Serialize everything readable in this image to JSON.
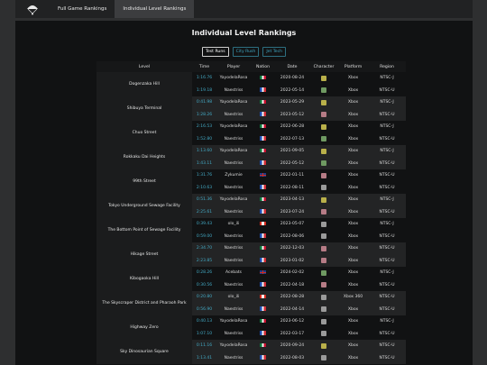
{
  "nav": {
    "logo_icon": "parachute-icon",
    "tabs": [
      {
        "label": "Full Game Rankings",
        "active": false
      },
      {
        "label": "Individual Level Rankings",
        "active": true
      }
    ]
  },
  "page_title": "Individual Level Rankings",
  "filters": [
    {
      "label": "Test Runs",
      "active": true
    },
    {
      "label": "City Rush",
      "active": false
    },
    {
      "label": "Jet Tech",
      "active": false
    }
  ],
  "table": {
    "headers": [
      "Level",
      "Time",
      "Player",
      "Nation",
      "Date",
      "Character",
      "Platform",
      "Region"
    ],
    "groups": [
      {
        "level": "Dogenzaka Hill",
        "runs": [
          {
            "time": "1:16.76",
            "player": "YayodelaRosa",
            "nation": "mx",
            "date": "2020-08-24",
            "character": "yellow",
            "platform": "Xbox",
            "region": "NTSC-J"
          },
          {
            "time": "1:19.18",
            "player": "Naestriss",
            "nation": "fr",
            "date": "2022-05-14",
            "character": "green",
            "platform": "Xbox",
            "region": "NTSC-U"
          }
        ]
      },
      {
        "level": "Shibuya Terminal",
        "runs": [
          {
            "time": "0:41.98",
            "player": "YayodelaRosa",
            "nation": "mx",
            "date": "2023-05-29",
            "character": "yellow",
            "platform": "Xbox",
            "region": "NTSC-J"
          },
          {
            "time": "1:28.26",
            "player": "Naestriss",
            "nation": "fr",
            "date": "2023-05-12",
            "character": "pink",
            "platform": "Xbox",
            "region": "NTSC-U"
          }
        ]
      },
      {
        "level": "Chuo Street",
        "runs": [
          {
            "time": "2:16.53",
            "player": "YayodelaRosa",
            "nation": "mx",
            "date": "2022-06-28",
            "character": "yellow",
            "platform": "Xbox",
            "region": "NTSC-J"
          },
          {
            "time": "1:52.80",
            "player": "Naestriss",
            "nation": "fr",
            "date": "2022-07-13",
            "character": "green",
            "platform": "Xbox",
            "region": "NTSC-U"
          }
        ]
      },
      {
        "level": "Rokkaku Dai Heights",
        "runs": [
          {
            "time": "1:13.60",
            "player": "YayodelaRosa",
            "nation": "mx",
            "date": "2021-09-05",
            "character": "yellow",
            "platform": "Xbox",
            "region": "NTSC-J"
          },
          {
            "time": "1:43.11",
            "player": "Naestriss",
            "nation": "fr",
            "date": "2022-05-12",
            "character": "green",
            "platform": "Xbox",
            "region": "NTSC-U"
          }
        ]
      },
      {
        "level": "99th Street",
        "runs": [
          {
            "time": "1:31.76",
            "player": "Zykumie",
            "nation": "uk",
            "date": "2022-01-11",
            "character": "pink",
            "platform": "Xbox",
            "region": "NTSC-U"
          },
          {
            "time": "2:10.63",
            "player": "Naestriss",
            "nation": "fr",
            "date": "2022-08-11",
            "character": "gray",
            "platform": "Xbox",
            "region": "NTSC-U"
          }
        ]
      },
      {
        "level": "Tokyo Underground Sewage Facility",
        "runs": [
          {
            "time": "0:51.36",
            "player": "YayodelaRosa",
            "nation": "mx",
            "date": "2023-04-13",
            "character": "yellow",
            "platform": "Xbox",
            "region": "NTSC-J"
          },
          {
            "time": "2:25.61",
            "player": "Naestriss",
            "nation": "fr",
            "date": "2023-07-24",
            "character": "pink",
            "platform": "Xbox",
            "region": "NTSC-U"
          }
        ]
      },
      {
        "level": "The Bottom Point of Sewage Facility",
        "runs": [
          {
            "time": "0:39.43",
            "player": "olo_ili",
            "nation": "ca",
            "date": "2023-05-07",
            "character": "gray",
            "platform": "Xbox",
            "region": "NTSC-J"
          },
          {
            "time": "0:59.00",
            "player": "Naestriss",
            "nation": "fr",
            "date": "2022-08-06",
            "character": "gray",
            "platform": "Xbox",
            "region": "NTSC-U"
          }
        ]
      },
      {
        "level": "Hikage Street",
        "runs": [
          {
            "time": "2:34.70",
            "player": "Naestriss",
            "nation": "mx",
            "date": "2022-12-03",
            "character": "pink",
            "platform": "Xbox",
            "region": "NTSC-U"
          },
          {
            "time": "2:23.85",
            "player": "Naestriss",
            "nation": "fr",
            "date": "2023-01-02",
            "character": "pink",
            "platform": "Xbox",
            "region": "NTSC-U"
          }
        ]
      },
      {
        "level": "Kibogaoka Hill",
        "runs": [
          {
            "time": "0:28.26",
            "player": "Acebats",
            "nation": "uk",
            "date": "2024-02-02",
            "character": "green",
            "platform": "Xbox",
            "region": "NTSC-J"
          },
          {
            "time": "0:30.56",
            "player": "Naestriss",
            "nation": "fr",
            "date": "2022-04-18",
            "character": "pink",
            "platform": "Xbox",
            "region": "NTSC-U"
          }
        ]
      },
      {
        "level": "The Skyscraper District and Pharaoh Park",
        "runs": [
          {
            "time": "0:20.80",
            "player": "olo_ili",
            "nation": "ca",
            "date": "2022-08-28",
            "character": "gray",
            "platform": "Xbox 360",
            "region": "NTSC-U"
          },
          {
            "time": "0:56.90",
            "player": "Naestriss",
            "nation": "fr",
            "date": "2022-04-14",
            "character": "gray",
            "platform": "Xbox",
            "region": "NTSC-U"
          }
        ]
      },
      {
        "level": "Highway Zero",
        "runs": [
          {
            "time": "0:40.13",
            "player": "YayodelaRosa",
            "nation": "mx",
            "date": "2023-06-12",
            "character": "gray",
            "platform": "Xbox",
            "region": "NTSC-J"
          },
          {
            "time": "1:07.10",
            "player": "Naestriss",
            "nation": "fr",
            "date": "2022-03-17",
            "character": "gray",
            "platform": "Xbox",
            "region": "NTSC-U"
          }
        ]
      },
      {
        "level": "Sky Dinosaurian Square",
        "runs": [
          {
            "time": "0:11.16",
            "player": "YayodelaRosa",
            "nation": "mx",
            "date": "2020-09-24",
            "character": "yellow",
            "platform": "Xbox",
            "region": "NTSC-U"
          },
          {
            "time": "1:13.41",
            "player": "Naestriss",
            "nation": "fr",
            "date": "2022-08-03",
            "character": "gray",
            "platform": "Xbox",
            "region": "NTSC-U"
          }
        ]
      }
    ]
  },
  "colors": {
    "time_link": "#43a9c4",
    "filter_border": "#2d6f80",
    "character_yellow": "#b9b04a",
    "character_green": "#6f9a62",
    "character_pink": "#b67c86",
    "character_gray": "#9a9a9a"
  }
}
